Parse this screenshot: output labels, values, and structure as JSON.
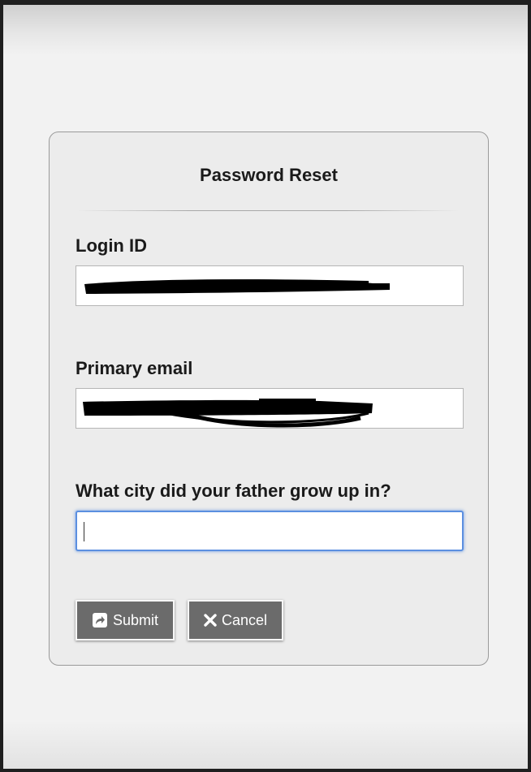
{
  "form": {
    "title": "Password Reset",
    "fields": [
      {
        "label": "Login ID",
        "value": ""
      },
      {
        "label": "Primary email",
        "value": ""
      },
      {
        "label": "What city did your father grow up in?",
        "value": ""
      }
    ],
    "buttons": {
      "submit_label": "Submit",
      "cancel_label": "Cancel"
    }
  },
  "colors": {
    "button_bg": "#6b6b6b",
    "focus_border": "#5b8fe0",
    "redaction": "#000000"
  },
  "icons": {
    "submit": "share-arrow-icon",
    "cancel": "close-x-icon"
  }
}
